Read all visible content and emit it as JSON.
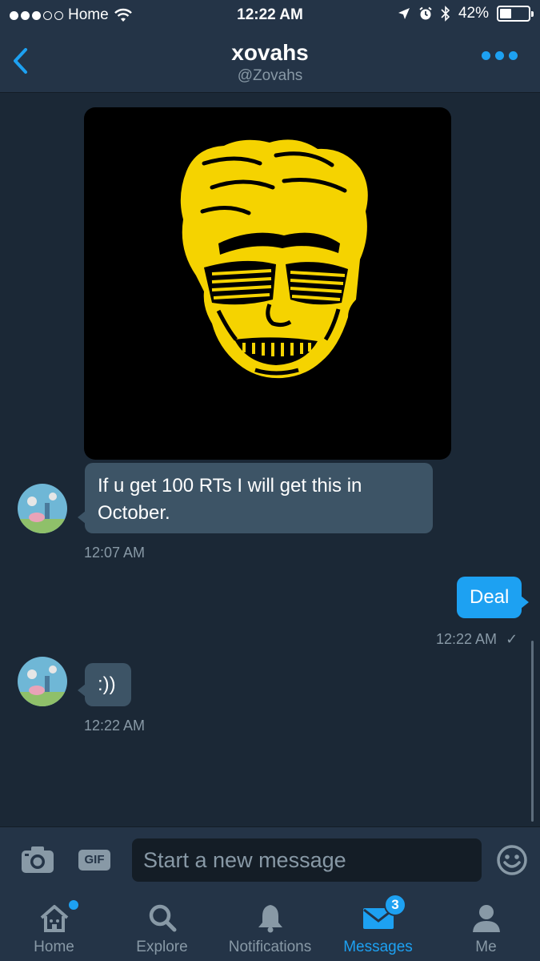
{
  "status_bar": {
    "carrier": "Home",
    "time": "12:22 AM",
    "battery": "42%",
    "battery_level": 0.42
  },
  "header": {
    "name": "xovahs",
    "handle": "@Zovahs"
  },
  "messages": [
    {
      "from": "them",
      "kind": "image",
      "text": "If u get 100 RTs I will get this in October.",
      "time": "12:07 AM"
    },
    {
      "from": "me",
      "text": "Deal",
      "time": "12:22 AM",
      "receipt": "✓"
    },
    {
      "from": "them",
      "text": ":))",
      "time": "12:22 AM"
    }
  ],
  "compose": {
    "gif_label": "GIF",
    "placeholder": "Start a new message"
  },
  "tabs": [
    {
      "label": "Home",
      "icon": "home-icon"
    },
    {
      "label": "Explore",
      "icon": "search-icon"
    },
    {
      "label": "Notifications",
      "icon": "bell-icon"
    },
    {
      "label": "Messages",
      "icon": "envelope-icon",
      "badge": "3",
      "active": true
    },
    {
      "label": "Me",
      "icon": "person-icon"
    }
  ],
  "colors": {
    "background": "#1b2836",
    "bar": "#243447",
    "accent": "#1da1f2",
    "incoming_bubble": "#3d5466",
    "muted": "#8899a6",
    "artwork_yellow": "#f5d300"
  }
}
